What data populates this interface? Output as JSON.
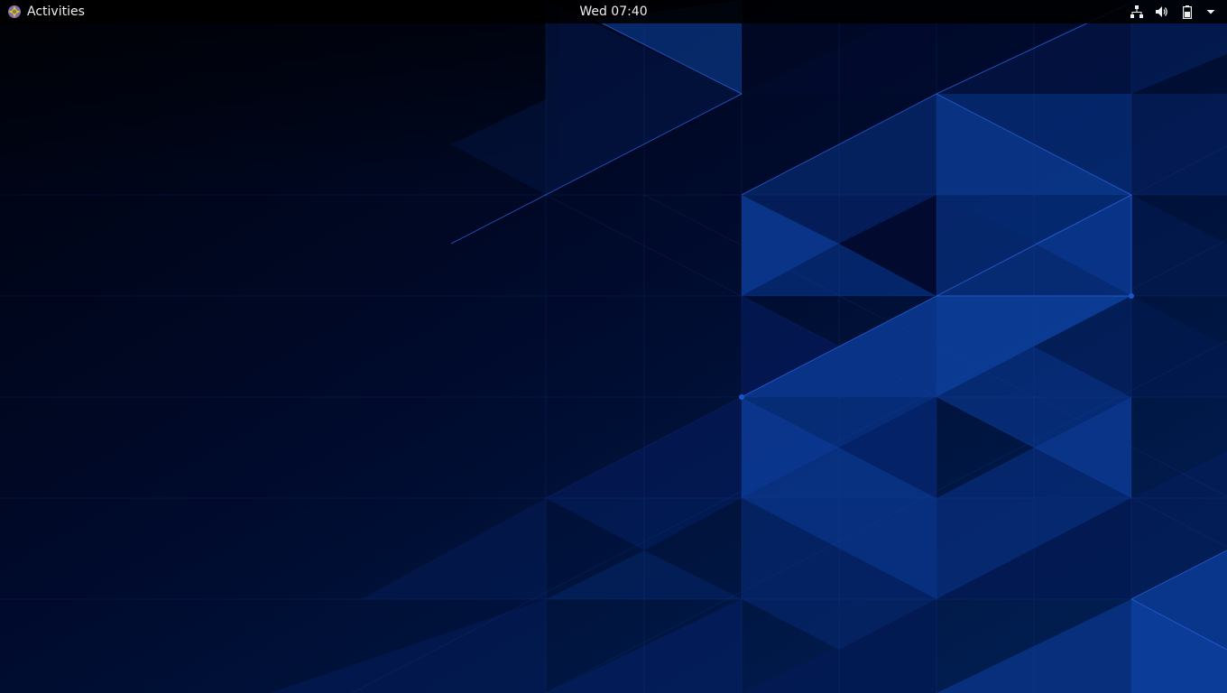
{
  "top_bar": {
    "activities_label": "Activities",
    "clock": "Wed 07:40",
    "status_icons": [
      "network-wired-icon",
      "volume-icon",
      "battery-icon",
      "system-menu-arrow-icon"
    ]
  },
  "colors": {
    "panel_bg": "#000000",
    "panel_text": "#eeeeec",
    "wallpaper_dark": "#000516",
    "wallpaper_mid": "#021a4a",
    "wallpaper_accent": "#0a3f9c"
  }
}
